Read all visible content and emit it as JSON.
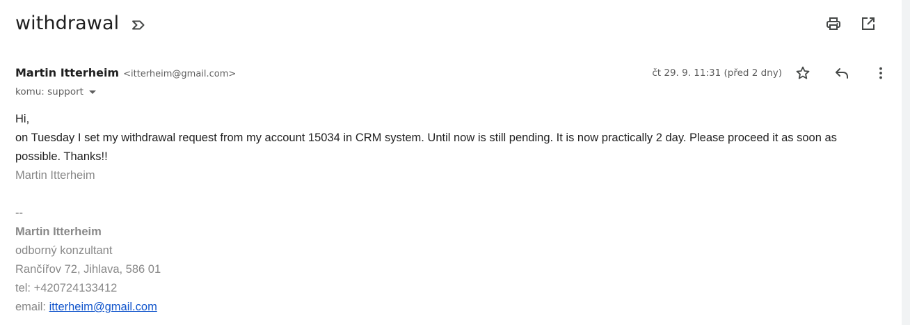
{
  "email": {
    "subject": "withdrawal",
    "sender_name": "Martin Itterheim",
    "sender_email": "<itterheim@gmail.com>",
    "recipient": "komu: support",
    "date": "čt 29. 9. 11:31 (před 2 dny)",
    "greeting": "Hi,",
    "body_text": "on Tuesday I set my withdrawal request from my account 15034 in CRM system. Until now is still pending. It is now practically 2 day. Please proceed it as soon as possible. Thanks!!",
    "closing_name": "Martin Itterheim",
    "signature": {
      "separator": "--",
      "name": "Martin Itterheim",
      "title": "odborný konzultant",
      "address": "Rančířov 72, Jihlava, 586 01",
      "phone": "tel: +420724133412",
      "email_label": "email: ",
      "email_link": "itterheim@gmail.com"
    }
  },
  "icons": {
    "label": "label-outline-icon",
    "print": "print-icon",
    "open_new_window": "open-in-new-window-icon",
    "star": "star-icon",
    "reply": "reply-icon",
    "more": "more-vert-icon"
  },
  "colors": {
    "link": "#1155cc",
    "signature": "#888888",
    "text": "#222222"
  }
}
